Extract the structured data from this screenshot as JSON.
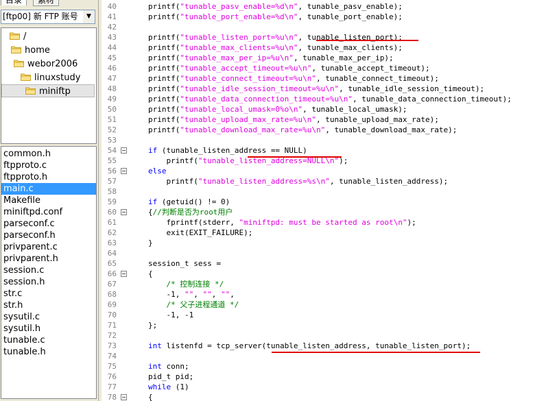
{
  "left_panel": {
    "tabs": [
      "目录",
      "素材"
    ],
    "combo_value": "[ftp00] 新 FTP 账号",
    "dirs": [
      "/",
      "home",
      "webor2006",
      "linuxstudy",
      "miniftp"
    ],
    "files": [
      "common.h",
      "ftpproto.c",
      "ftpproto.h",
      "main.c",
      "Makefile",
      "miniftpd.conf",
      "parseconf.c",
      "parseconf.h",
      "privparent.c",
      "privparent.h",
      "session.c",
      "session.h",
      "str.c",
      "str.h",
      "sysutil.c",
      "sysutil.h",
      "tunable.c",
      "tunable.h"
    ],
    "selected_file": "main.c"
  },
  "editor": {
    "lines": [
      {
        "n": "40",
        "fold": false,
        "segs": [
          [
            "t",
            "printf("
          ],
          [
            "s",
            "\"tunable_pasv_enable=%d\\n\""
          ],
          [
            "t",
            ", tunable_pasv_enable);"
          ]
        ]
      },
      {
        "n": "41",
        "fold": false,
        "segs": [
          [
            "t",
            "printf("
          ],
          [
            "s",
            "\"tunable_port_enable=%d\\n\""
          ],
          [
            "t",
            ", tunable_port_enable);"
          ]
        ]
      },
      {
        "n": "42",
        "fold": false,
        "segs": []
      },
      {
        "n": "43",
        "fold": false,
        "segs": [
          [
            "t",
            "printf("
          ],
          [
            "s",
            "\"tunable_listen_port=%u\\n\""
          ],
          [
            "t",
            ", tunable_listen_port);"
          ]
        ]
      },
      {
        "n": "44",
        "fold": false,
        "segs": [
          [
            "t",
            "printf("
          ],
          [
            "s",
            "\"tunable_max_clients=%u\\n\""
          ],
          [
            "t",
            ", tunable_max_clients);"
          ]
        ]
      },
      {
        "n": "45",
        "fold": false,
        "segs": [
          [
            "t",
            "printf("
          ],
          [
            "s",
            "\"tunable_max_per_ip=%u\\n\""
          ],
          [
            "t",
            ", tunable_max_per_ip);"
          ]
        ]
      },
      {
        "n": "46",
        "fold": false,
        "segs": [
          [
            "t",
            "printf("
          ],
          [
            "s",
            "\"tunable_accept_timeout=%u\\n\""
          ],
          [
            "t",
            ", tunable_accept_timeout);"
          ]
        ]
      },
      {
        "n": "47",
        "fold": false,
        "segs": [
          [
            "t",
            "printf("
          ],
          [
            "s",
            "\"tunable_connect_timeout=%u\\n\""
          ],
          [
            "t",
            ", tunable_connect_timeout);"
          ]
        ]
      },
      {
        "n": "48",
        "fold": false,
        "segs": [
          [
            "t",
            "printf("
          ],
          [
            "s",
            "\"tunable_idle_session_timeout=%u\\n\""
          ],
          [
            "t",
            ", tunable_idle_session_timeout);"
          ]
        ]
      },
      {
        "n": "49",
        "fold": false,
        "segs": [
          [
            "t",
            "printf("
          ],
          [
            "s",
            "\"tunable_data_connection_timeout=%u\\n\""
          ],
          [
            "t",
            ", tunable_data_connection_timeout);"
          ]
        ]
      },
      {
        "n": "50",
        "fold": false,
        "segs": [
          [
            "t",
            "printf("
          ],
          [
            "s",
            "\"tunable_local_umask=0%o\\n\""
          ],
          [
            "t",
            ", tunable_local_umask);"
          ]
        ]
      },
      {
        "n": "51",
        "fold": false,
        "segs": [
          [
            "t",
            "printf("
          ],
          [
            "s",
            "\"tunable_upload_max_rate=%u\\n\""
          ],
          [
            "t",
            ", tunable_upload_max_rate);"
          ]
        ]
      },
      {
        "n": "52",
        "fold": false,
        "segs": [
          [
            "t",
            "printf("
          ],
          [
            "s",
            "\"tunable_download_max_rate=%u\\n\""
          ],
          [
            "t",
            ", tunable_download_max_rate);"
          ]
        ]
      },
      {
        "n": "53",
        "fold": false,
        "segs": []
      },
      {
        "n": "54",
        "fold": true,
        "segs": [
          [
            "k",
            "if"
          ],
          [
            "t",
            " (tunable_listen_address == NULL)"
          ]
        ]
      },
      {
        "n": "55",
        "fold": false,
        "segs": [
          [
            "t",
            "    printf("
          ],
          [
            "s",
            "\"tunable_listen_address=NULL\\n\""
          ],
          [
            "t",
            ");"
          ]
        ]
      },
      {
        "n": "56",
        "fold": true,
        "segs": [
          [
            "k",
            "else"
          ]
        ]
      },
      {
        "n": "57",
        "fold": false,
        "segs": [
          [
            "t",
            "    printf("
          ],
          [
            "s",
            "\"tunable_listen_address=%s\\n\""
          ],
          [
            "t",
            ", tunable_listen_address);"
          ]
        ]
      },
      {
        "n": "58",
        "fold": false,
        "segs": []
      },
      {
        "n": "59",
        "fold": false,
        "segs": [
          [
            "k",
            "if"
          ],
          [
            "t",
            " (getuid() != 0)"
          ]
        ]
      },
      {
        "n": "60",
        "fold": true,
        "segs": [
          [
            "t",
            "{"
          ],
          [
            "c",
            "//判断是否为root用户"
          ]
        ]
      },
      {
        "n": "61",
        "fold": false,
        "segs": [
          [
            "t",
            "    fprintf(stderr, "
          ],
          [
            "s",
            "\"miniftpd: must be started as root\\n\""
          ],
          [
            "t",
            ");"
          ]
        ]
      },
      {
        "n": "62",
        "fold": false,
        "segs": [
          [
            "t",
            "    exit(EXIT_FAILURE);"
          ]
        ]
      },
      {
        "n": "63",
        "fold": false,
        "segs": [
          [
            "t",
            "}"
          ]
        ]
      },
      {
        "n": "64",
        "fold": false,
        "segs": []
      },
      {
        "n": "65",
        "fold": false,
        "segs": [
          [
            "t",
            "session_t sess ="
          ]
        ]
      },
      {
        "n": "66",
        "fold": true,
        "segs": [
          [
            "t",
            "{"
          ]
        ]
      },
      {
        "n": "67",
        "fold": false,
        "segs": [
          [
            "c",
            "    /* 控制连接 */"
          ]
        ]
      },
      {
        "n": "68",
        "fold": false,
        "segs": [
          [
            "t",
            "    -1, "
          ],
          [
            "s",
            "\"\""
          ],
          [
            "t",
            ", "
          ],
          [
            "s",
            "\"\""
          ],
          [
            "t",
            ", "
          ],
          [
            "s",
            "\"\""
          ],
          [
            "t",
            ","
          ]
        ]
      },
      {
        "n": "69",
        "fold": false,
        "segs": [
          [
            "c",
            "    /* 父子进程通道 */"
          ]
        ]
      },
      {
        "n": "70",
        "fold": false,
        "segs": [
          [
            "t",
            "    -1, -1"
          ]
        ]
      },
      {
        "n": "71",
        "fold": false,
        "segs": [
          [
            "t",
            "};"
          ]
        ]
      },
      {
        "n": "72",
        "fold": false,
        "segs": []
      },
      {
        "n": "73",
        "fold": false,
        "segs": [
          [
            "k",
            "int"
          ],
          [
            "t",
            " listenfd = tcp_server(tunable_listen_address, tunable_listen_port);"
          ]
        ]
      },
      {
        "n": "74",
        "fold": false,
        "segs": []
      },
      {
        "n": "75",
        "fold": false,
        "segs": [
          [
            "k",
            "int"
          ],
          [
            "t",
            " conn;"
          ]
        ]
      },
      {
        "n": "76",
        "fold": false,
        "segs": [
          [
            "t",
            "pid_t pid;"
          ]
        ]
      },
      {
        "n": "77",
        "fold": false,
        "segs": [
          [
            "k",
            "while"
          ],
          [
            "t",
            " (1)"
          ]
        ]
      },
      {
        "n": "78",
        "fold": true,
        "segs": [
          [
            "t",
            "{"
          ]
        ]
      }
    ],
    "highlight_color": "#e00000"
  }
}
